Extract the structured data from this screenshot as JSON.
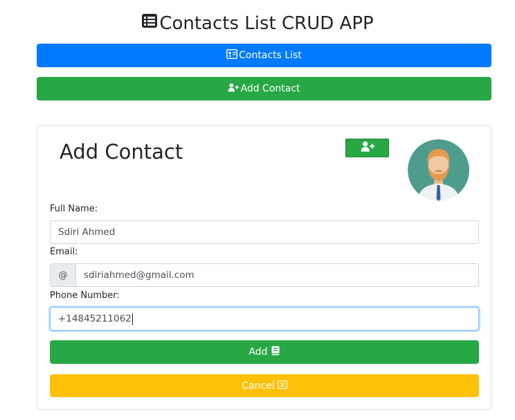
{
  "header": {
    "title": "Contacts List CRUD APP",
    "title_icon": "list-icon"
  },
  "nav": {
    "contacts_list_label": "Contacts List",
    "contacts_list_icon": "address-card-icon",
    "add_contact_label": "Add Contact",
    "add_contact_icon": "user-plus-icon"
  },
  "form": {
    "heading": "Add Contact",
    "small_button_icon": "user-plus-icon",
    "avatar_icon": "man-avatar-icon",
    "full_name_label": "Full Name:",
    "full_name_value": "Sdiri Ahmed",
    "email_label": "Email:",
    "email_addon": "@",
    "email_value": "sdiriahmed@gmail.com",
    "phone_label": "Phone Number:",
    "phone_value": "+14845211062",
    "add_button_label": "Add",
    "add_button_icon": "book-icon",
    "cancel_button_label": "Cancel",
    "cancel_button_icon": "close-box-icon"
  },
  "colors": {
    "primary": "#007bff",
    "success": "#28a745",
    "warning": "#ffc107"
  }
}
